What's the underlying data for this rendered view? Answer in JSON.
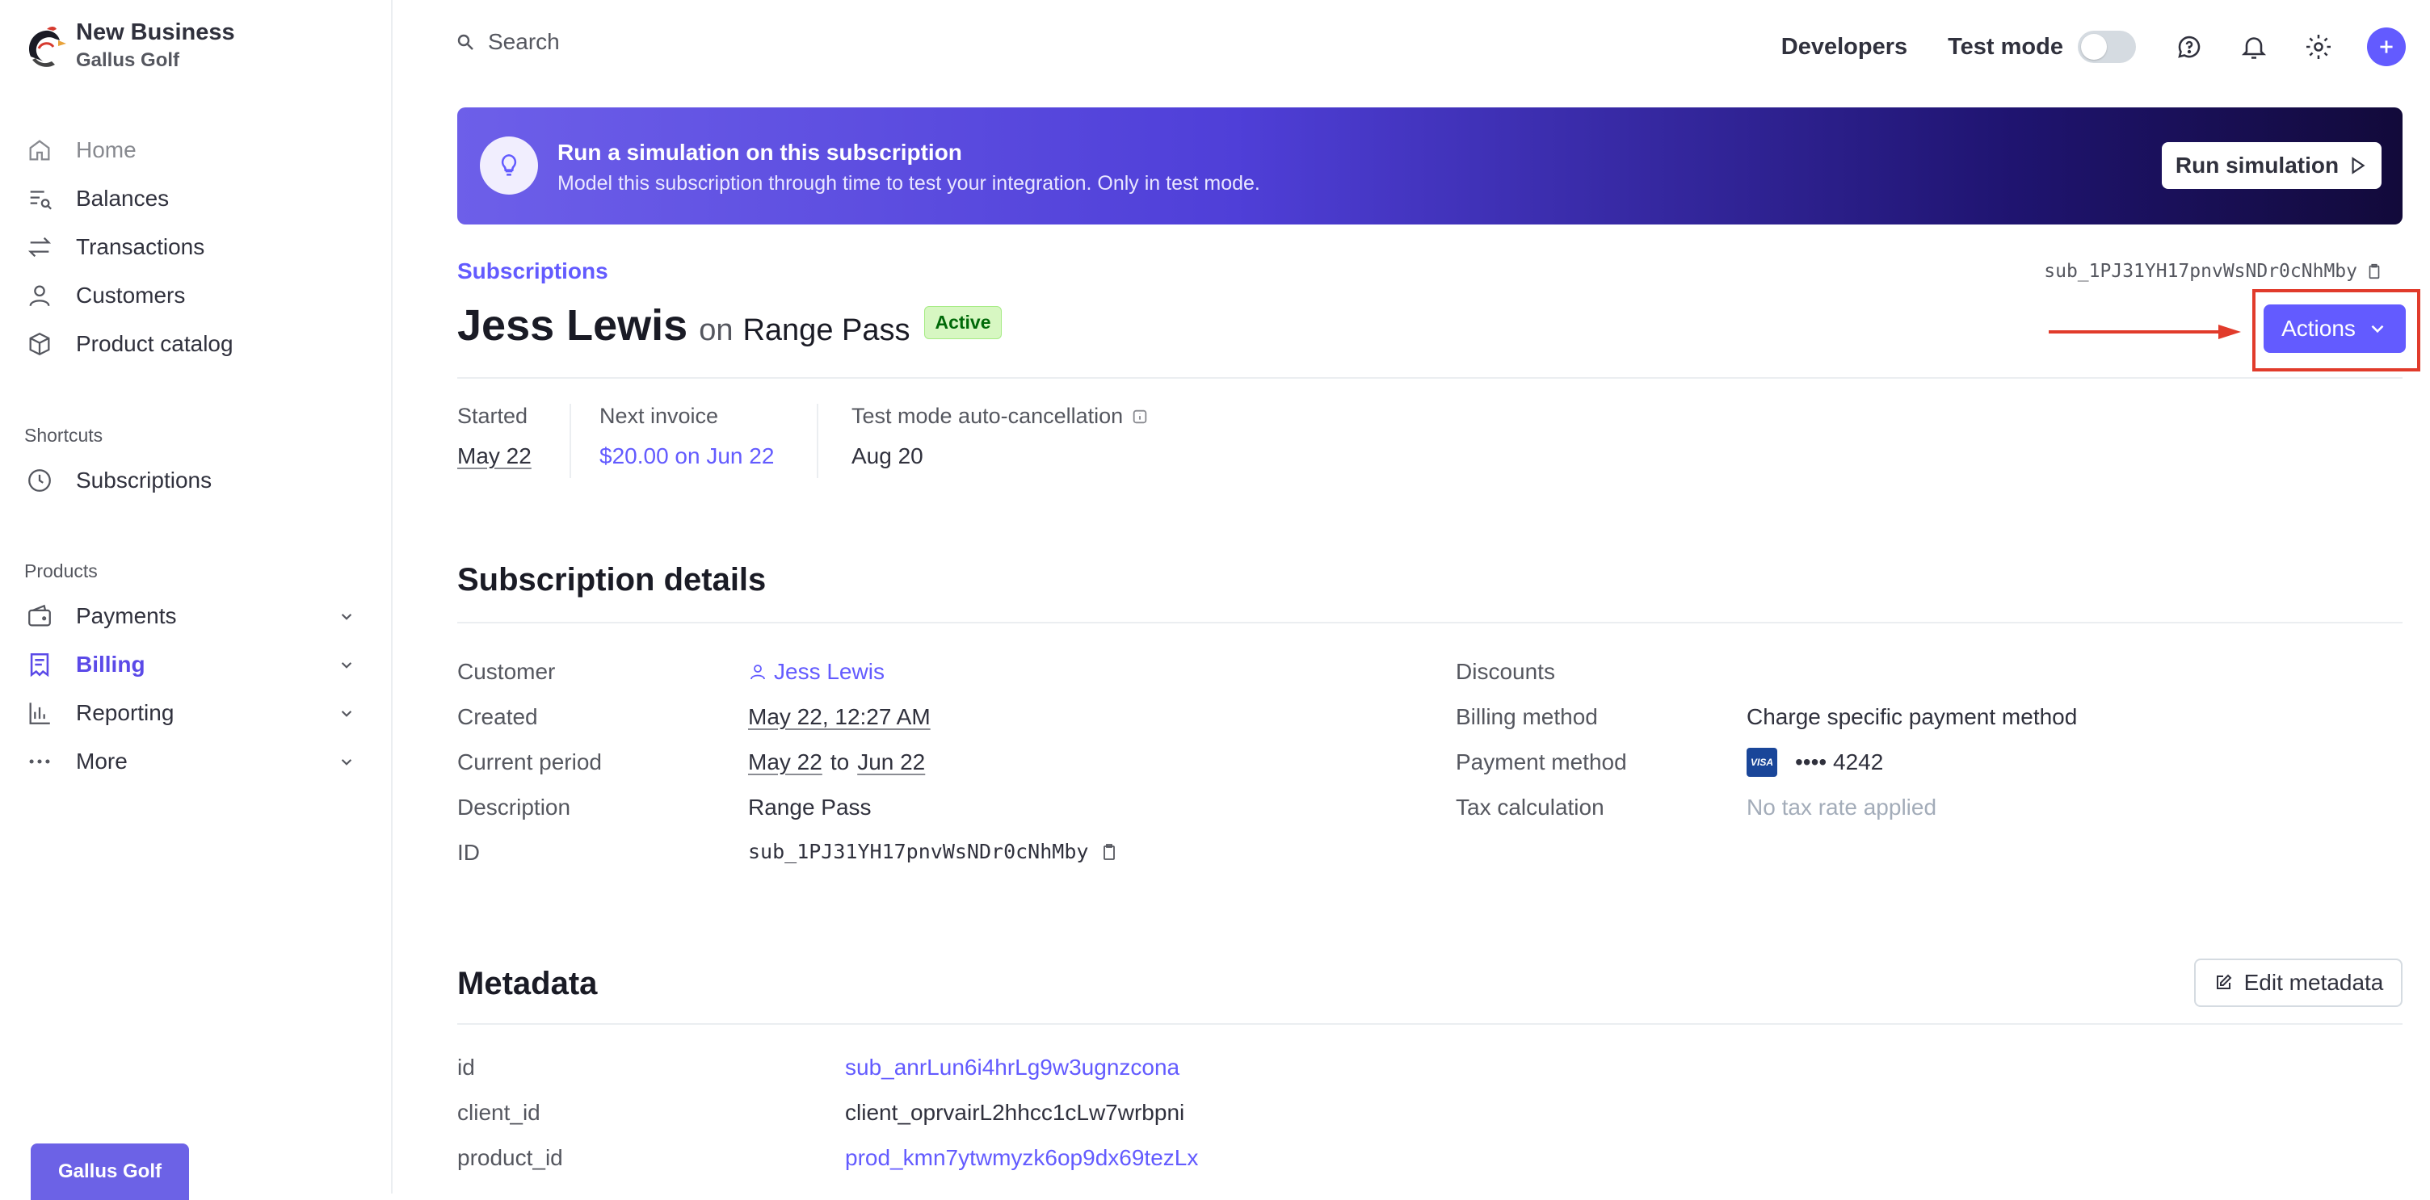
{
  "sidebar": {
    "account_name": "New Business",
    "account_sub": "Gallus Golf",
    "nav": [
      {
        "label": "Home",
        "icon": "home-icon"
      },
      {
        "label": "Balances",
        "icon": "balances-icon"
      },
      {
        "label": "Transactions",
        "icon": "transactions-icon"
      },
      {
        "label": "Customers",
        "icon": "customers-icon"
      },
      {
        "label": "Product catalog",
        "icon": "box-icon"
      }
    ],
    "shortcuts_label": "Shortcuts",
    "shortcuts": [
      {
        "label": "Subscriptions",
        "icon": "clock-icon"
      }
    ],
    "products_label": "Products",
    "products": [
      {
        "label": "Payments",
        "icon": "wallet-icon"
      },
      {
        "label": "Billing",
        "icon": "billing-icon"
      },
      {
        "label": "Reporting",
        "icon": "chart-icon"
      },
      {
        "label": "More",
        "icon": "dots-icon"
      }
    ],
    "footer_button": "Gallus Golf"
  },
  "topbar": {
    "search_placeholder": "Search",
    "developers": "Developers",
    "test_mode": "Test mode",
    "test_mode_on": false
  },
  "banner": {
    "title": "Run a simulation on this subscription",
    "subtitle": "Model this subscription through time to test your integration. Only in test mode.",
    "button": "Run simulation"
  },
  "header": {
    "breadcrumb": "Subscriptions",
    "sub_id": "sub_1PJ31YH17pnvWsNDr0cNhMby",
    "customer": "Jess Lewis",
    "on": "on",
    "plan": "Range Pass",
    "status": "Active",
    "actions": "Actions"
  },
  "summary": {
    "started_label": "Started",
    "started_value": "May 22",
    "next_label": "Next invoice",
    "next_value": "$20.00 on Jun 22",
    "cancel_label": "Test mode auto-cancellation",
    "cancel_value": "Aug 20"
  },
  "details": {
    "heading": "Subscription details",
    "customer_label": "Customer",
    "customer_value": "Jess Lewis",
    "created_label": "Created",
    "created_value": "May 22, 12:27 AM",
    "period_label": "Current period",
    "period_start": "May 22",
    "period_to": "to",
    "period_end": "Jun 22",
    "description_label": "Description",
    "description_value": "Range Pass",
    "id_label": "ID",
    "id_value": "sub_1PJ31YH17pnvWsNDr0cNhMby",
    "discounts_label": "Discounts",
    "billing_label": "Billing method",
    "billing_value": "Charge specific payment method",
    "payment_label": "Payment method",
    "card_brand": "VISA",
    "card_value": "•••• 4242",
    "tax_label": "Tax calculation",
    "tax_value": "No tax rate applied"
  },
  "metadata": {
    "heading": "Metadata",
    "edit_button": "Edit metadata",
    "rows": [
      {
        "key": "id",
        "value": "sub_anrLun6i4hrLg9w3ugnzcona"
      },
      {
        "key": "client_id",
        "value": "client_oprvairL2hhcc1cLw7wrbpni"
      },
      {
        "key": "product_id",
        "value": "prod_kmn7ytwmyzk6op9dx69tezLx"
      }
    ]
  },
  "colors": {
    "accent": "#635bff",
    "annotation": "#e13b2b",
    "active_badge_bg": "#d7f7c2"
  }
}
